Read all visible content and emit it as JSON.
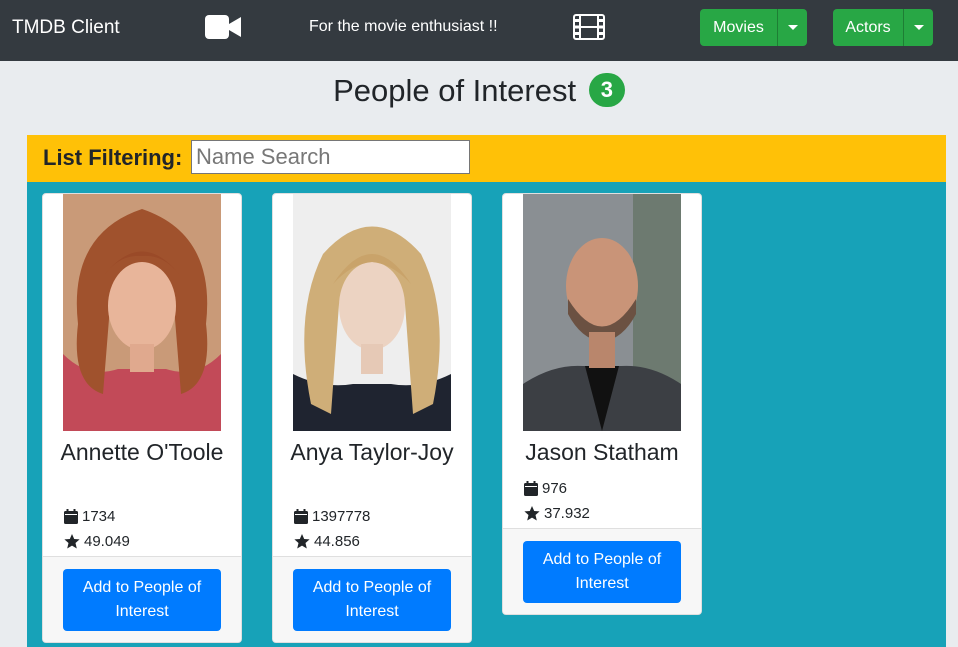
{
  "navbar": {
    "brand": "TMDB Client",
    "tagline": "For the movie enthusiast !!",
    "movies_label": "Movies",
    "actors_label": "Actors"
  },
  "page": {
    "title": "People of Interest",
    "count": "3"
  },
  "filter": {
    "label": "List Filtering:",
    "placeholder": "Name Search",
    "value": ""
  },
  "people": [
    {
      "name": "Annette O'Toole",
      "count": "1734",
      "popularity": "49.049",
      "button": "Add to People of Interest"
    },
    {
      "name": "Anya Taylor-Joy",
      "count": "1397778",
      "popularity": "44.856",
      "button": "Add to People of Interest"
    },
    {
      "name": "Jason Statham",
      "count": "976",
      "popularity": "37.932",
      "button": "Add to People of Interest"
    }
  ],
  "colors": {
    "navbar": "#343a40",
    "success": "#28a745",
    "warning": "#ffc107",
    "info": "#17a2b8",
    "primary": "#007bff"
  }
}
